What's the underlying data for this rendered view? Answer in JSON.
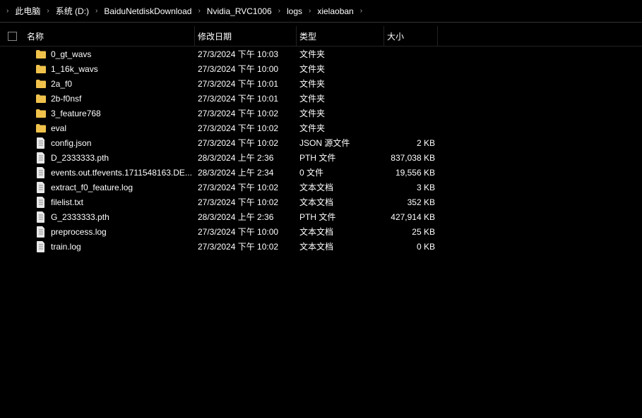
{
  "breadcrumb": [
    "此电脑",
    "系统 (D:)",
    "BaiduNetdiskDownload",
    "Nvidia_RVC1006",
    "logs",
    "xielaoban"
  ],
  "columns": {
    "name": "名称",
    "date": "修改日期",
    "type": "类型",
    "size": "大小"
  },
  "rows": [
    {
      "icon": "folder",
      "name": "0_gt_wavs",
      "date": "27/3/2024 下午 10:03",
      "type": "文件夹",
      "size": ""
    },
    {
      "icon": "folder",
      "name": "1_16k_wavs",
      "date": "27/3/2024 下午 10:00",
      "type": "文件夹",
      "size": ""
    },
    {
      "icon": "folder",
      "name": "2a_f0",
      "date": "27/3/2024 下午 10:01",
      "type": "文件夹",
      "size": ""
    },
    {
      "icon": "folder",
      "name": "2b-f0nsf",
      "date": "27/3/2024 下午 10:01",
      "type": "文件夹",
      "size": ""
    },
    {
      "icon": "folder",
      "name": "3_feature768",
      "date": "27/3/2024 下午 10:02",
      "type": "文件夹",
      "size": ""
    },
    {
      "icon": "folder",
      "name": "eval",
      "date": "27/3/2024 下午 10:02",
      "type": "文件夹",
      "size": ""
    },
    {
      "icon": "file",
      "name": "config.json",
      "date": "27/3/2024 下午 10:02",
      "type": "JSON 源文件",
      "size": "2 KB"
    },
    {
      "icon": "file",
      "name": "D_2333333.pth",
      "date": "28/3/2024 上午 2:36",
      "type": "PTH 文件",
      "size": "837,038 KB"
    },
    {
      "icon": "file",
      "name": "events.out.tfevents.1711548163.DE...",
      "date": "28/3/2024 上午 2:34",
      "type": "0 文件",
      "size": "19,556 KB"
    },
    {
      "icon": "file",
      "name": "extract_f0_feature.log",
      "date": "27/3/2024 下午 10:02",
      "type": "文本文档",
      "size": "3 KB"
    },
    {
      "icon": "file",
      "name": "filelist.txt",
      "date": "27/3/2024 下午 10:02",
      "type": "文本文档",
      "size": "352 KB"
    },
    {
      "icon": "file",
      "name": "G_2333333.pth",
      "date": "28/3/2024 上午 2:36",
      "type": "PTH 文件",
      "size": "427,914 KB"
    },
    {
      "icon": "file",
      "name": "preprocess.log",
      "date": "27/3/2024 下午 10:00",
      "type": "文本文档",
      "size": "25 KB"
    },
    {
      "icon": "file",
      "name": "train.log",
      "date": "27/3/2024 下午 10:02",
      "type": "文本文档",
      "size": "0 KB"
    }
  ]
}
